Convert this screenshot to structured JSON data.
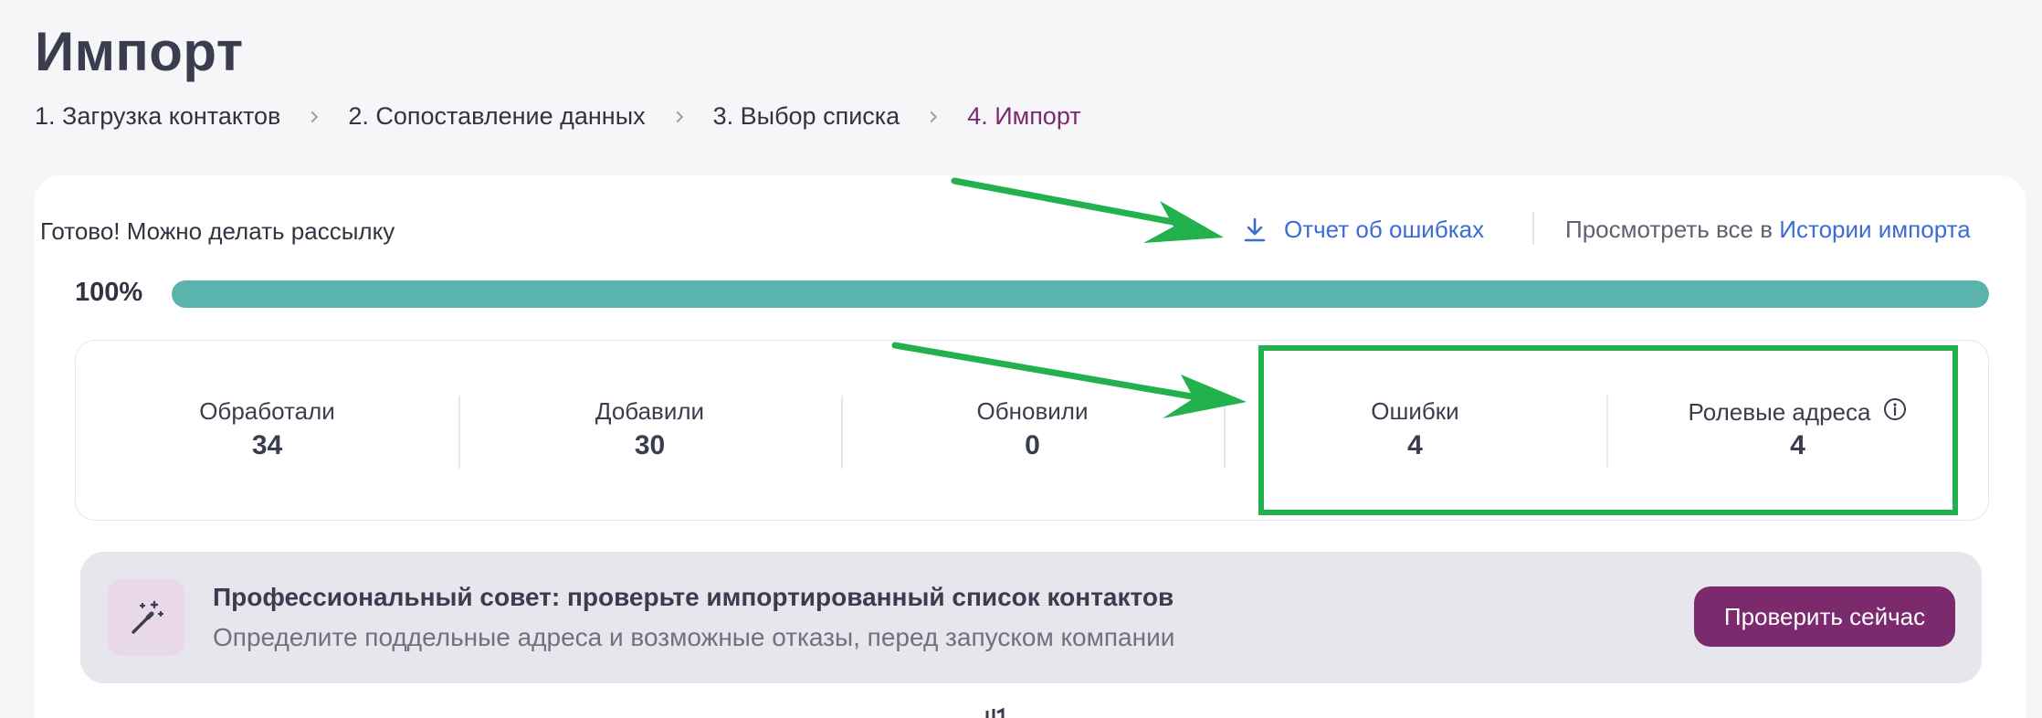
{
  "page": {
    "title": "Импорт"
  },
  "steps": [
    {
      "label": "1. Загрузка контактов"
    },
    {
      "label": "2. Сопоставление данных"
    },
    {
      "label": "3. Выбор списка"
    },
    {
      "label": "4. Импорт"
    }
  ],
  "status": {
    "message": "Готово! Можно делать рассылку",
    "error_report_label": "Отчет об ошибках",
    "history_prefix": "Просмотреть все в",
    "history_link": "Истории импорта"
  },
  "progress": {
    "label": "100%",
    "value": 1.0
  },
  "stats": [
    {
      "label": "Обработали",
      "value": "34"
    },
    {
      "label": "Добавили",
      "value": "30"
    },
    {
      "label": "Обновили",
      "value": "0"
    },
    {
      "label": "Ошибки",
      "value": "4"
    },
    {
      "label": "Ролевые адреса",
      "value": "4"
    }
  ],
  "tip": {
    "title": "Профессиональный совет: проверьте импортированный список контактов",
    "subtitle": "Определите поддельные адреса и возможные отказы, перед запуском компании",
    "button_label": "Проверить сейчас"
  },
  "icons": {
    "download": "download-icon",
    "chevron": "chevron-right-icon",
    "info": "info-icon",
    "tip": "magic-wand-icon"
  },
  "colors": {
    "accent": "#7b2a6e",
    "link": "#3b6bd6",
    "progress": "#5bb3ad",
    "annotation": "#22b14c"
  }
}
